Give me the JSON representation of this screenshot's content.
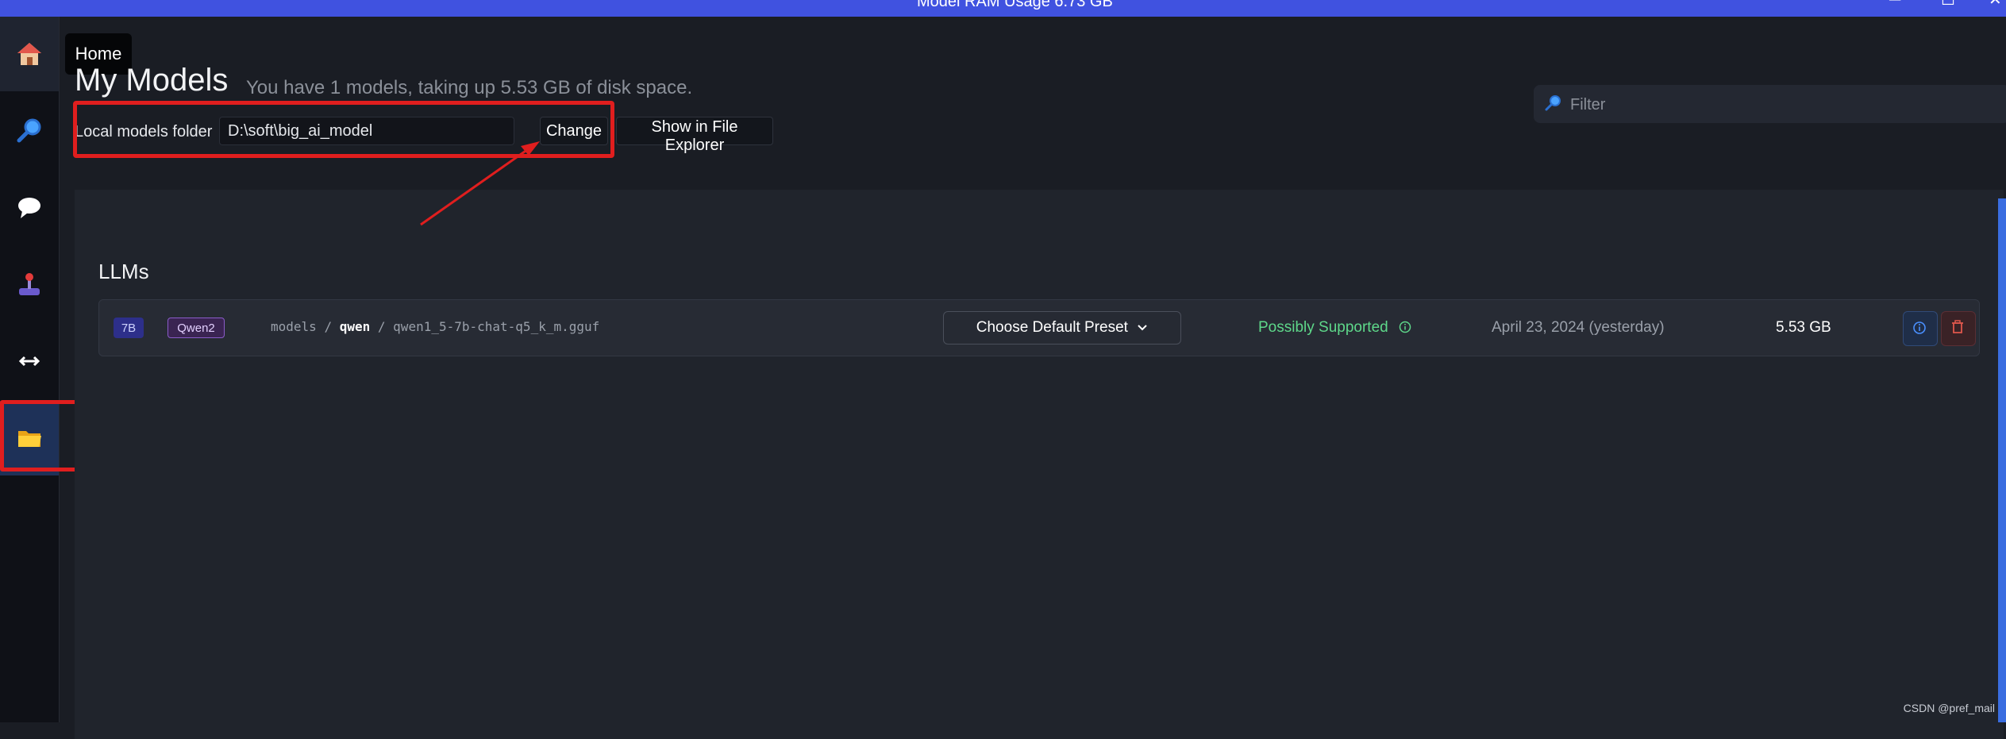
{
  "titlebar": {
    "title": "Model RAM Usage  6.73 GB",
    "minimize_glyph": "─",
    "maximize_glyph": "☐",
    "close_glyph": "✕"
  },
  "sidebar": {
    "items": [
      {
        "name": "home",
        "icon": "house-icon",
        "active": true
      },
      {
        "name": "search",
        "icon": "magnifier-icon"
      },
      {
        "name": "chat",
        "icon": "speech-bubble-icon"
      },
      {
        "name": "playground",
        "icon": "joystick-icon"
      },
      {
        "name": "server",
        "icon": "left-right-arrow-icon"
      },
      {
        "name": "my-models",
        "icon": "folder-icon",
        "active": true
      }
    ],
    "tooltip": "Home"
  },
  "header": {
    "title": "My Models",
    "subtitle": "You have 1 models, taking up 5.53 GB of disk space.",
    "folder_label": "Local models folder",
    "folder_value": "D:\\soft\\big_ai_model",
    "change_label": "Change",
    "explorer_label": "Show in File Explorer",
    "filter_placeholder": "Filter"
  },
  "section": {
    "title": "LLMs"
  },
  "models": [
    {
      "size_badge": "7B",
      "arch_badge": "Qwen2",
      "path_prefix": "models",
      "path_sep1": "/",
      "path_publisher": "qwen",
      "path_sep2": "/",
      "path_file": "qwen1_5-7b-chat-q5_k_m.gguf",
      "preset_label": "Choose Default Preset",
      "support": "Possibly Supported",
      "date": "April 23, 2024 (yesterday)",
      "size": "5.53 GB"
    }
  ],
  "watermark": "CSDN @pref_mail",
  "colors": {
    "accent_titlebar": "#4052e0",
    "annotation_red": "#e01e1e",
    "support_green": "#5ed88a"
  }
}
